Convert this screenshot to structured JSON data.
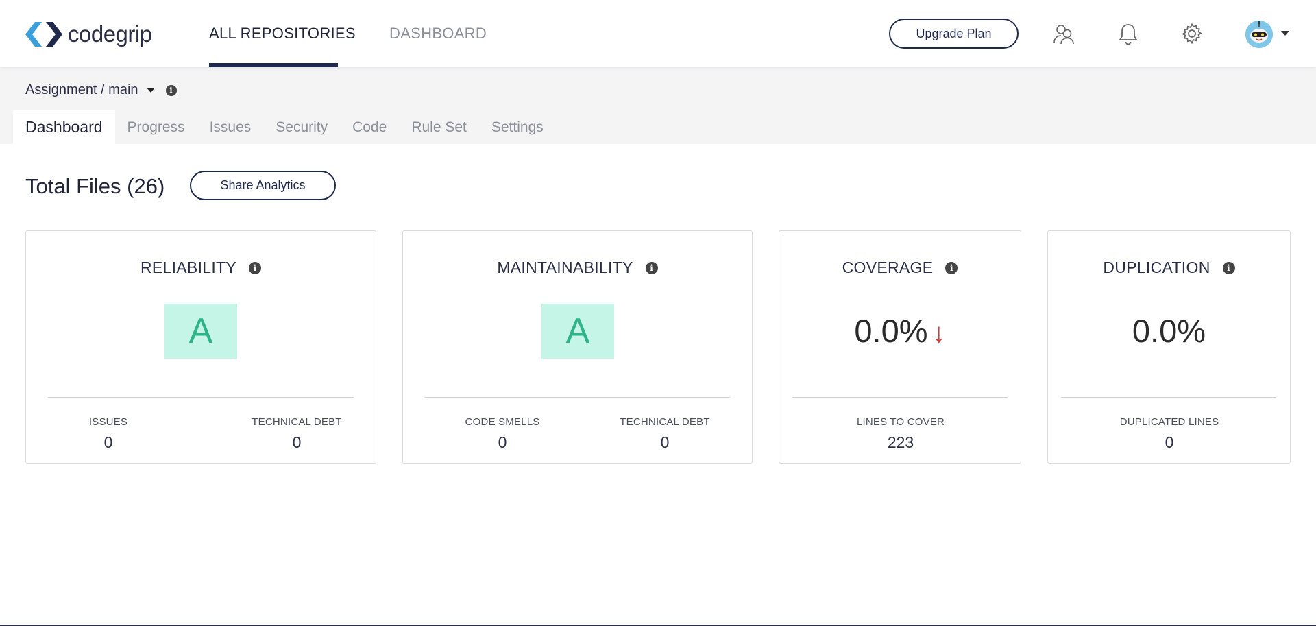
{
  "header": {
    "logo_text": "codegrip",
    "nav": [
      {
        "label": "ALL REPOSITORIES"
      },
      {
        "label": "DASHBOARD"
      }
    ],
    "upgrade_label": "Upgrade Plan",
    "icons": [
      "team-icon",
      "bell-icon",
      "gear-icon",
      "avatar"
    ]
  },
  "breadcrumb": {
    "text": "Assignment / main"
  },
  "tabs": [
    {
      "label": "Dashboard"
    },
    {
      "label": "Progress"
    },
    {
      "label": "Issues"
    },
    {
      "label": "Security"
    },
    {
      "label": "Code"
    },
    {
      "label": "Rule Set"
    },
    {
      "label": "Settings"
    }
  ],
  "summary": {
    "total_files": "Total Files (26)",
    "share_label": "Share Analytics"
  },
  "cards": {
    "reliability": {
      "title": "RELIABILITY",
      "grade": "A",
      "metrics": [
        {
          "label": "ISSUES",
          "value": "0"
        },
        {
          "label": "TECHNICAL DEBT",
          "value": "0"
        }
      ]
    },
    "maintainability": {
      "title": "MAINTAINABILITY",
      "grade": "A",
      "metrics": [
        {
          "label": "CODE SMELLS",
          "value": "0"
        },
        {
          "label": "TECHNICAL DEBT",
          "value": "0"
        }
      ]
    },
    "coverage": {
      "title": "COVERAGE",
      "value": "0.0%",
      "trend_arrow": "↓",
      "metrics": [
        {
          "label": "LINES TO COVER",
          "value": "223"
        }
      ]
    },
    "duplication": {
      "title": "DUPLICATION",
      "value": "0.0%",
      "metrics": [
        {
          "label": "DUPLICATED LINES",
          "value": "0"
        }
      ]
    }
  },
  "colors": {
    "navy": "#1f2a4d",
    "grade_bg": "#c4f5e6",
    "grade_fg": "#2fb48a",
    "trend_down": "#d63a3a"
  }
}
